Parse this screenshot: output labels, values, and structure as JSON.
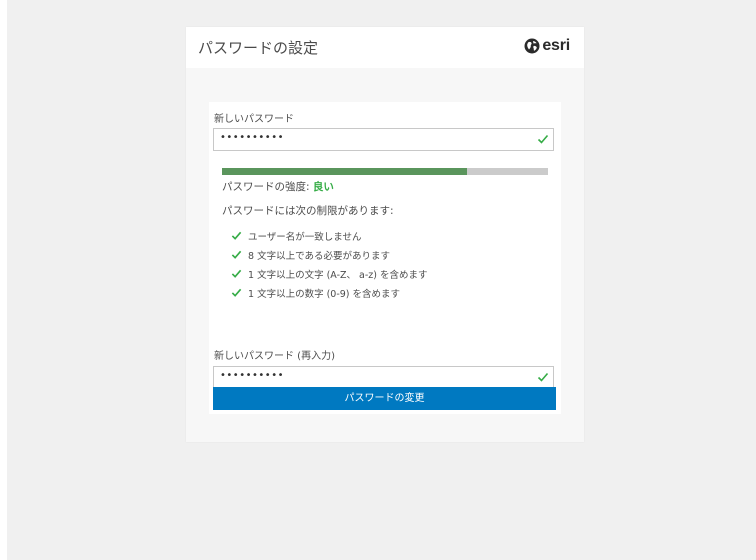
{
  "header": {
    "title": "パスワードの設定",
    "brand": "esri",
    "brand_icon": "globe-icon"
  },
  "form": {
    "new_password": {
      "label": "新しいパスワード",
      "value": "••••••••••",
      "valid": true
    },
    "strength": {
      "label": "パスワードの強度: ",
      "value": "良い",
      "level": 0.75,
      "color": "#5a955c"
    },
    "rules": {
      "title": "パスワードには次の制限があります:",
      "items": [
        {
          "text": "ユーザー名が一致しません",
          "met": true
        },
        {
          "text": "8 文字以上である必要があります",
          "met": true
        },
        {
          "text": "1 文字以上の文字 (A-Z、 a-z) を含めます",
          "met": true
        },
        {
          "text": "1 文字以上の数字 (0-9) を含めます",
          "met": true
        }
      ]
    },
    "confirm_password": {
      "label": "新しいパスワード (再入力)",
      "value": "••••••••••",
      "valid": true
    },
    "submit_label": "パスワードの変更"
  },
  "colors": {
    "accent": "#0079c1",
    "valid": "#35ac46",
    "strength_bar": "#5a955c"
  }
}
